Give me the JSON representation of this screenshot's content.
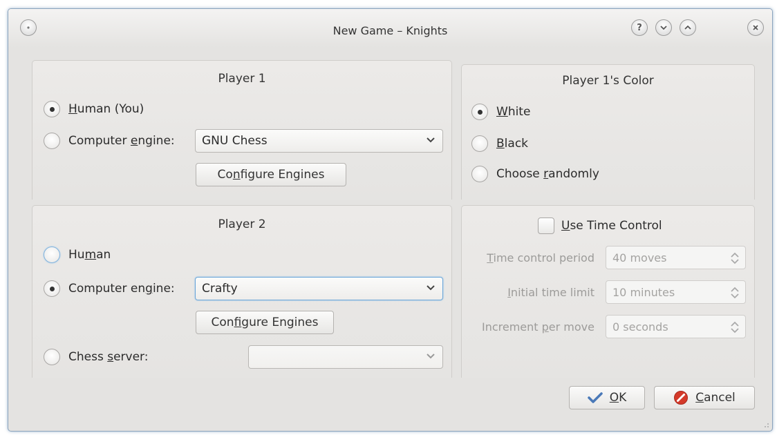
{
  "window": {
    "title": "New Game – Knights",
    "buttons": {
      "menu_icon": "window-menu-icon",
      "help_icon": "help-icon",
      "minimize_icon": "minimize-icon",
      "maximize_icon": "maximize-icon",
      "close_icon": "close-icon"
    }
  },
  "player1": {
    "title": "Player 1",
    "human": {
      "label_pre": "",
      "label_mn": "H",
      "label_post": "uman (You)",
      "selected": true
    },
    "engine": {
      "label_pre": "Computer ",
      "label_mn": "e",
      "label_post": "ngine:",
      "selected": false
    },
    "engine_combo": {
      "value": "GNU Chess"
    },
    "configure": {
      "label_pre": "Co",
      "label_mn": "n",
      "label_post": "figure Engines"
    }
  },
  "player2": {
    "title": "Player 2",
    "human": {
      "label_pre": "Hu",
      "label_mn": "m",
      "label_post": "an",
      "selected": false
    },
    "engine": {
      "label_pre": "Computer en",
      "label_mn": "g",
      "label_post": "ine:",
      "selected": true
    },
    "engine_combo": {
      "value": "Crafty"
    },
    "configure": {
      "label_pre": "Con",
      "label_mn": "f",
      "label_post": "igure Engines"
    },
    "server": {
      "label_pre": "Chess ",
      "label_mn": "s",
      "label_post": "erver:",
      "selected": false
    },
    "server_combo": {
      "value": ""
    }
  },
  "color": {
    "title": "Player 1's Color",
    "white": {
      "label_pre": "",
      "label_mn": "W",
      "label_post": "hite",
      "selected": true
    },
    "black": {
      "label_pre": "",
      "label_mn": "B",
      "label_post": "lack",
      "selected": false
    },
    "random": {
      "label_pre": "Choose ",
      "label_mn": "r",
      "label_post": "andomly",
      "selected": false
    }
  },
  "time_control": {
    "checkbox": {
      "label_pre": "",
      "label_mn": "U",
      "label_post": "se Time Control",
      "checked": false
    },
    "period": {
      "label_pre": "",
      "label_mn": "T",
      "label_post": "ime control period",
      "value": "40 moves"
    },
    "initial": {
      "label_pre": "",
      "label_mn": "I",
      "label_post": "nitial time limit",
      "value": "10 minutes"
    },
    "increment": {
      "label_pre": "Increment ",
      "label_mn": "p",
      "label_post": "er move",
      "value": "0 seconds"
    }
  },
  "dialog_buttons": {
    "ok": {
      "label_pre": "",
      "label_mn": "O",
      "label_post": "K",
      "icon": "check-icon"
    },
    "cancel": {
      "label_pre": "",
      "label_mn": "C",
      "label_post": "ancel",
      "icon": "cancel-icon"
    }
  },
  "colors": {
    "ok_check": "#4a79b8",
    "cancel_red": "#d43a2a",
    "focus_blue": "#6aa5d8"
  }
}
